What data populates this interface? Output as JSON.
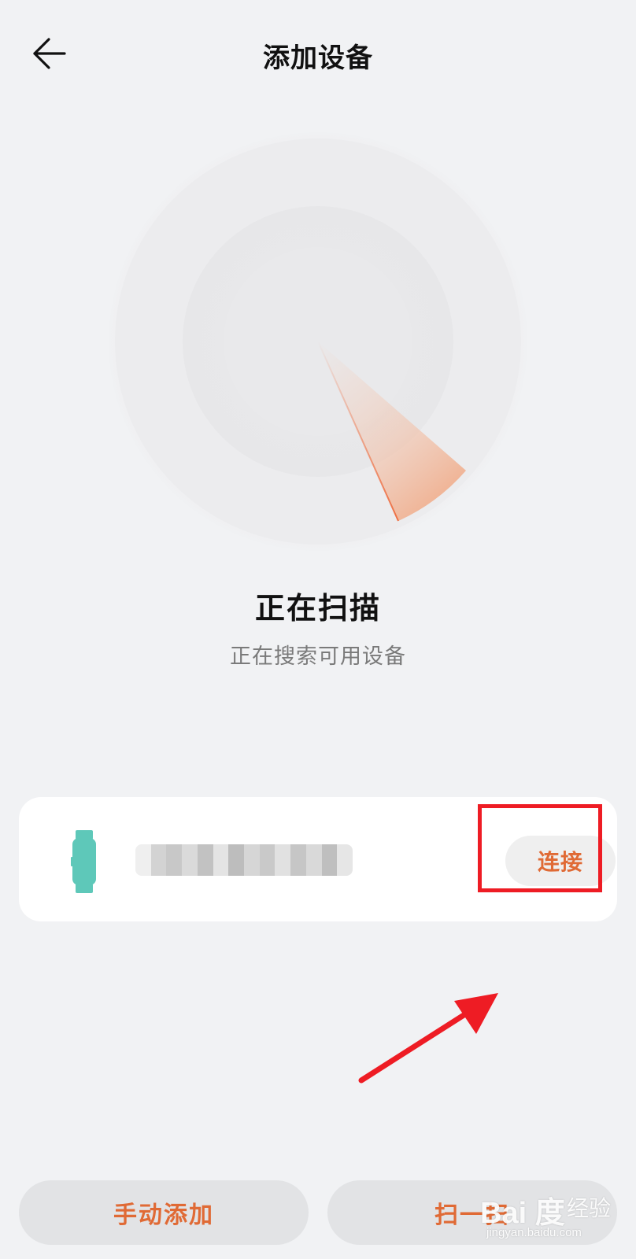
{
  "header": {
    "title": "添加设备",
    "back_icon": "arrow-left-icon"
  },
  "scan": {
    "title": "正在扫描",
    "subtitle": "正在搜索可用设备"
  },
  "device": {
    "icon": "smart-band-icon",
    "name": "",
    "connect_label": "连接"
  },
  "bottom": {
    "manual_label": "手动添加",
    "scan_label": "扫一扫"
  },
  "watermark": {
    "logo": "Bai 度",
    "cn": "经验",
    "url": "jingyan.baidu.com"
  },
  "colors": {
    "accent": "#e06a35",
    "background": "#f1f2f4",
    "device_icon": "#5ec8b9",
    "annotation": "#ee1c24"
  }
}
